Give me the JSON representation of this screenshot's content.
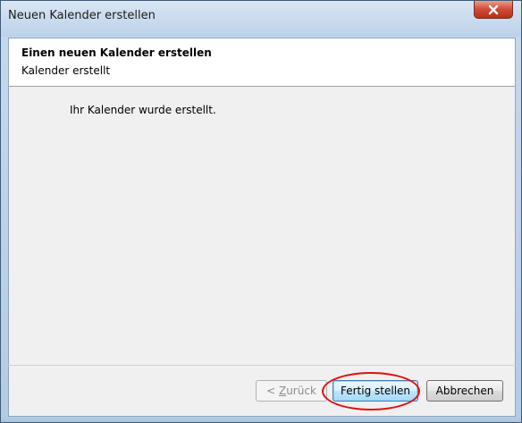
{
  "window": {
    "title": "Neuen Kalender erstellen",
    "close_icon": "close-icon"
  },
  "header": {
    "title": "Einen neuen Kalender erstellen",
    "subtitle": "Kalender erstellt"
  },
  "content": {
    "message": "Ihr Kalender wurde erstellt."
  },
  "footer": {
    "back_prefix": "< ",
    "back_mnemonic": "Z",
    "back_rest": "urück",
    "finish_label": "Fertig stellen",
    "cancel_label": "Abbrechen"
  },
  "colors": {
    "highlight": "#e01010",
    "titlebar": "#c6d9ee",
    "close_button": "#cf4a33",
    "default_button": "#bee6fd"
  }
}
